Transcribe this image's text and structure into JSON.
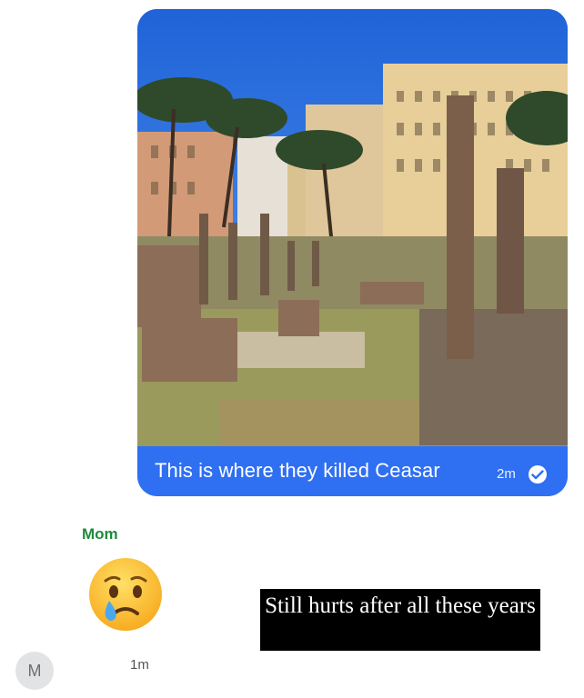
{
  "outgoing_message": {
    "photo_alt": "Ruins with columns in front of city buildings",
    "caption": "This is where they killed Ceasar",
    "time": "2m",
    "status_icon": "read-receipt-icon"
  },
  "incoming_message": {
    "sender": "Mom",
    "emoji": "crying-face",
    "time": "1m",
    "avatar_initial": "M"
  },
  "overlay": {
    "text": "Still hurts after all these years"
  },
  "colors": {
    "bubble_blue": "#2f6ff2",
    "sender_green": "#1f8a3c"
  }
}
